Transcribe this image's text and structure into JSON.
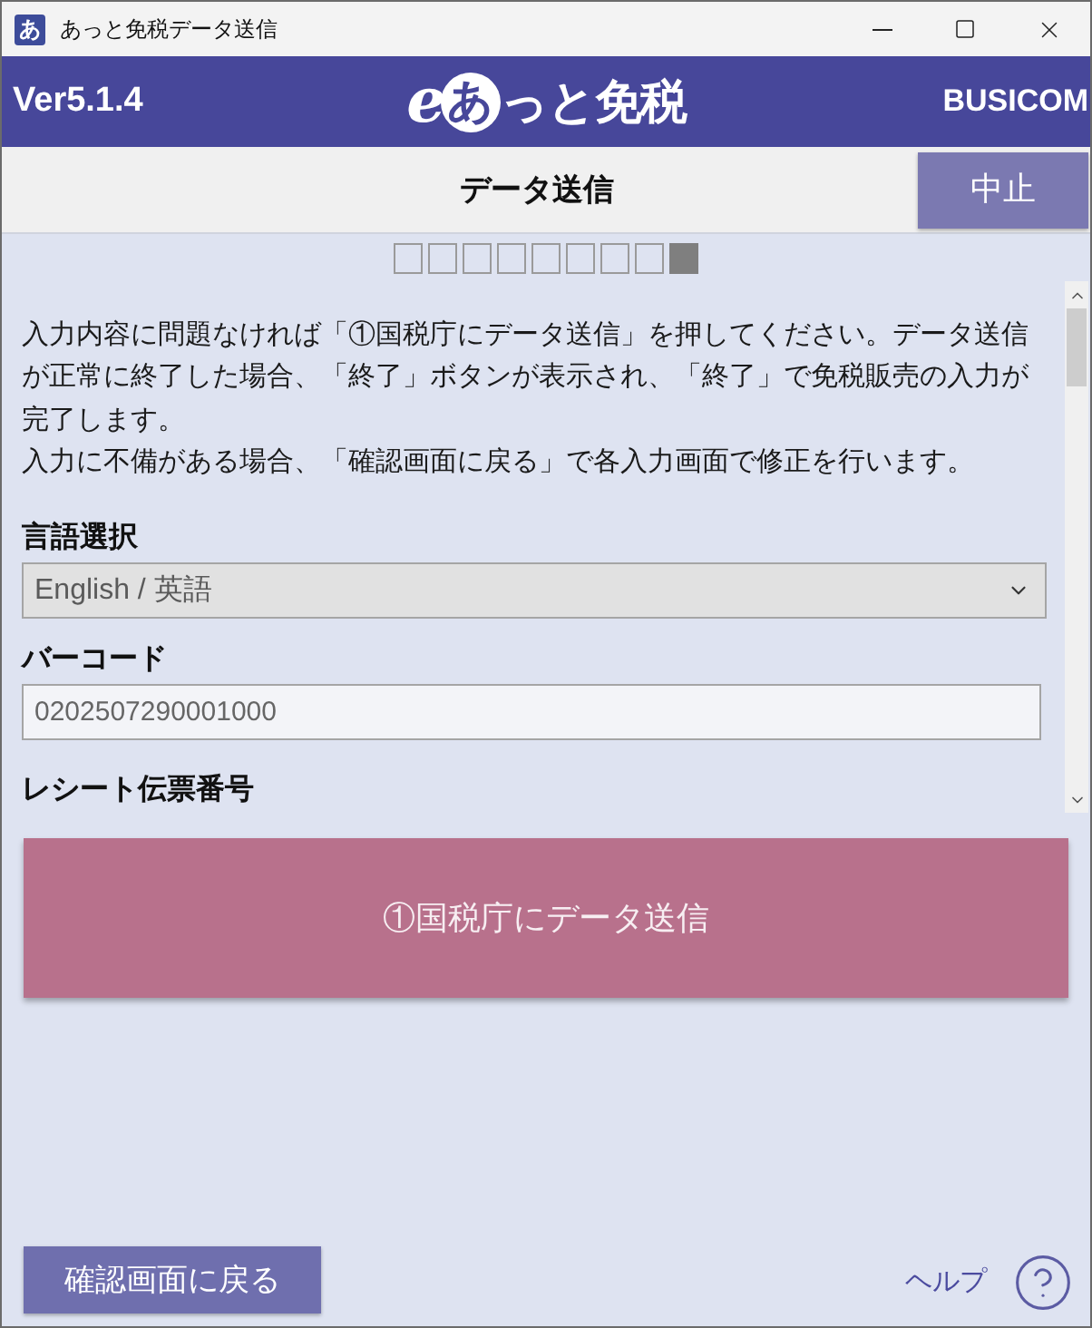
{
  "window": {
    "icon": "あ",
    "title": "あっと免税データ送信"
  },
  "header": {
    "version": "Ver5.1.4",
    "logo": {
      "prefix": "e",
      "mark": "あ",
      "text": "っと免税"
    },
    "company": "BUSICOM"
  },
  "page": {
    "title": "データ送信",
    "cancel_button": "中止"
  },
  "steps": [
    {
      "selected": false
    },
    {
      "selected": false
    },
    {
      "selected": false
    },
    {
      "selected": false
    },
    {
      "selected": false
    },
    {
      "selected": false
    },
    {
      "selected": false
    },
    {
      "selected": false
    },
    {
      "selected": true
    }
  ],
  "instructions": [
    "入力内容に問題なければ「①国税庁にデータ送信」を押してください。データ送信が正常に終了した場合、「終了」ボタンが表示され、「終了」で免税販売の入力が完了します。",
    "入力に不備がある場合、「確認画面に戻る」で各入力画面で修正を行います。"
  ],
  "form": {
    "fields": [
      {
        "kind": "select",
        "label": "言語選択",
        "value": "English / 英語"
      },
      {
        "kind": "input",
        "label": "バーコード",
        "value": "0202507290001000"
      },
      {
        "kind": "label",
        "label": "レシート伝票番号"
      }
    ]
  },
  "send_button": "①国税庁にデータ送信",
  "footer": {
    "back_button": "確認画面に戻る",
    "help_link": "ヘルプ"
  }
}
